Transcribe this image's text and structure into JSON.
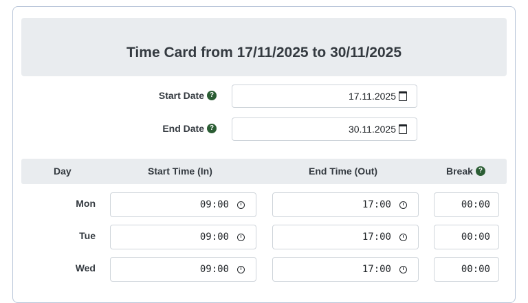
{
  "title": "Time Card from 17/11/2025 to 30/11/2025",
  "form": {
    "start_date_label": "Start Date",
    "start_date_value": "17.11.2025",
    "end_date_label": "End Date",
    "end_date_value": "30.11.2025",
    "help_glyph": "?"
  },
  "table": {
    "headers": {
      "day": "Day",
      "start": "Start Time (In)",
      "end": "End Time (Out)",
      "break": "Break"
    },
    "rows": [
      {
        "day": "Mon",
        "start": "09:00",
        "end": "17:00",
        "break": "00:00"
      },
      {
        "day": "Tue",
        "start": "09:00",
        "end": "17:00",
        "break": "00:00"
      },
      {
        "day": "Wed",
        "start": "09:00",
        "end": "17:00",
        "break": "00:00"
      }
    ]
  },
  "colors": {
    "help_icon": "#2b5d34",
    "header_bg": "#e9ecef",
    "card_border": "#b9c6d9"
  },
  "icons": [
    "help-icon",
    "calendar-icon",
    "clock-icon"
  ]
}
